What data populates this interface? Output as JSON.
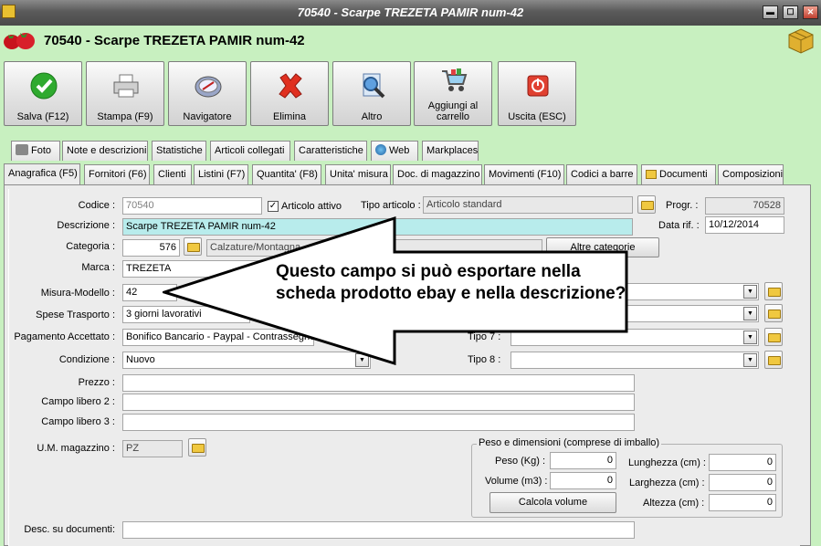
{
  "window": {
    "title": "70540 - Scarpe TREZETA PAMIR num-42",
    "minimize": "▬",
    "maximize": "☐",
    "close": "✕"
  },
  "header": {
    "title": "70540 - Scarpe TREZETA PAMIR num-42"
  },
  "toolbar": {
    "save": "Salva (F12)",
    "print": "Stampa (F9)",
    "navigator": "Navigatore",
    "delete": "Elimina",
    "other": "Altro",
    "add_cart_1": "Aggiungi al",
    "add_cart_2": "carrello",
    "exit": "Uscita (ESC)"
  },
  "tabs_row1": [
    "Foto",
    "Note e descrizioni",
    "Statistiche",
    "Articoli collegati",
    "Caratteristiche",
    "Web",
    "Markplaces"
  ],
  "tabs_row2": [
    "Anagrafica (F5)",
    "Fornitori (F6)",
    "Clienti",
    "Listini (F7)",
    "Quantita' (F8)",
    "Unita' misura",
    "Doc. di magazzino",
    "Movimenti (F10)",
    "Codici a barre",
    "Documenti",
    "Composizioni"
  ],
  "form": {
    "codice_label": "Codice :",
    "codice_value": "70540",
    "articolo_attivo": "Articolo attivo",
    "articolo_attivo_check": "✓",
    "tipo_articolo_label": "Tipo articolo :",
    "tipo_articolo_value": "Articolo standard",
    "progr_label": "Progr. :",
    "progr_value": "70528",
    "descrizione_label": "Descrizione :",
    "descrizione_value": "Scarpe TREZETA PAMIR num-42",
    "data_rif_label": "Data rif. :",
    "data_rif_value": "10/12/2014",
    "categoria_label": "Categoria :",
    "categoria_num": "576",
    "categoria_text": "Calzature/Montagna",
    "altre_categorie": "Altre categorie",
    "marca_label": "Marca :",
    "marca_value": "TREZETA",
    "misura_label": "Misura-Modello :",
    "misura_value": "42",
    "spese_label": "Spese Trasporto :",
    "spese_value": "3 giorni lavorativi",
    "pagamento_label": "Pagamento Accettato :",
    "pagamento_value": "Bonifico Bancario -  Paypal  - Contrassegno",
    "condizione_label": "Condizione :",
    "condizione_value": "Nuovo",
    "tipo7_label": "Tipo 7 :",
    "tipo8_label": "Tipo 8 :",
    "prezzo_label": "Prezzo :",
    "campo2_label": "Campo libero 2 :",
    "campo3_label": "Campo libero 3 :",
    "um_label": "U.M. magazzino :",
    "um_value": "PZ",
    "desc_doc_label": "Desc. su documenti:",
    "dd_arrow": "▼"
  },
  "peso_group": {
    "title": "Peso e dimensioni (comprese di imballo)",
    "peso_label": "Peso (Kg) :",
    "peso_value": "0",
    "volume_label": "Volume (m3) :",
    "volume_value": "0",
    "lunghezza_label": "Lunghezza (cm) :",
    "lunghezza_value": "0",
    "larghezza_label": "Larghezza (cm) :",
    "larghezza_value": "0",
    "altezza_label": "Altezza (cm) :",
    "altezza_value": "0",
    "calcola": "Calcola volume"
  },
  "callout": {
    "text": "Questo campo si può esportare nella scheda prodotto ebay e nella descrizione?"
  }
}
